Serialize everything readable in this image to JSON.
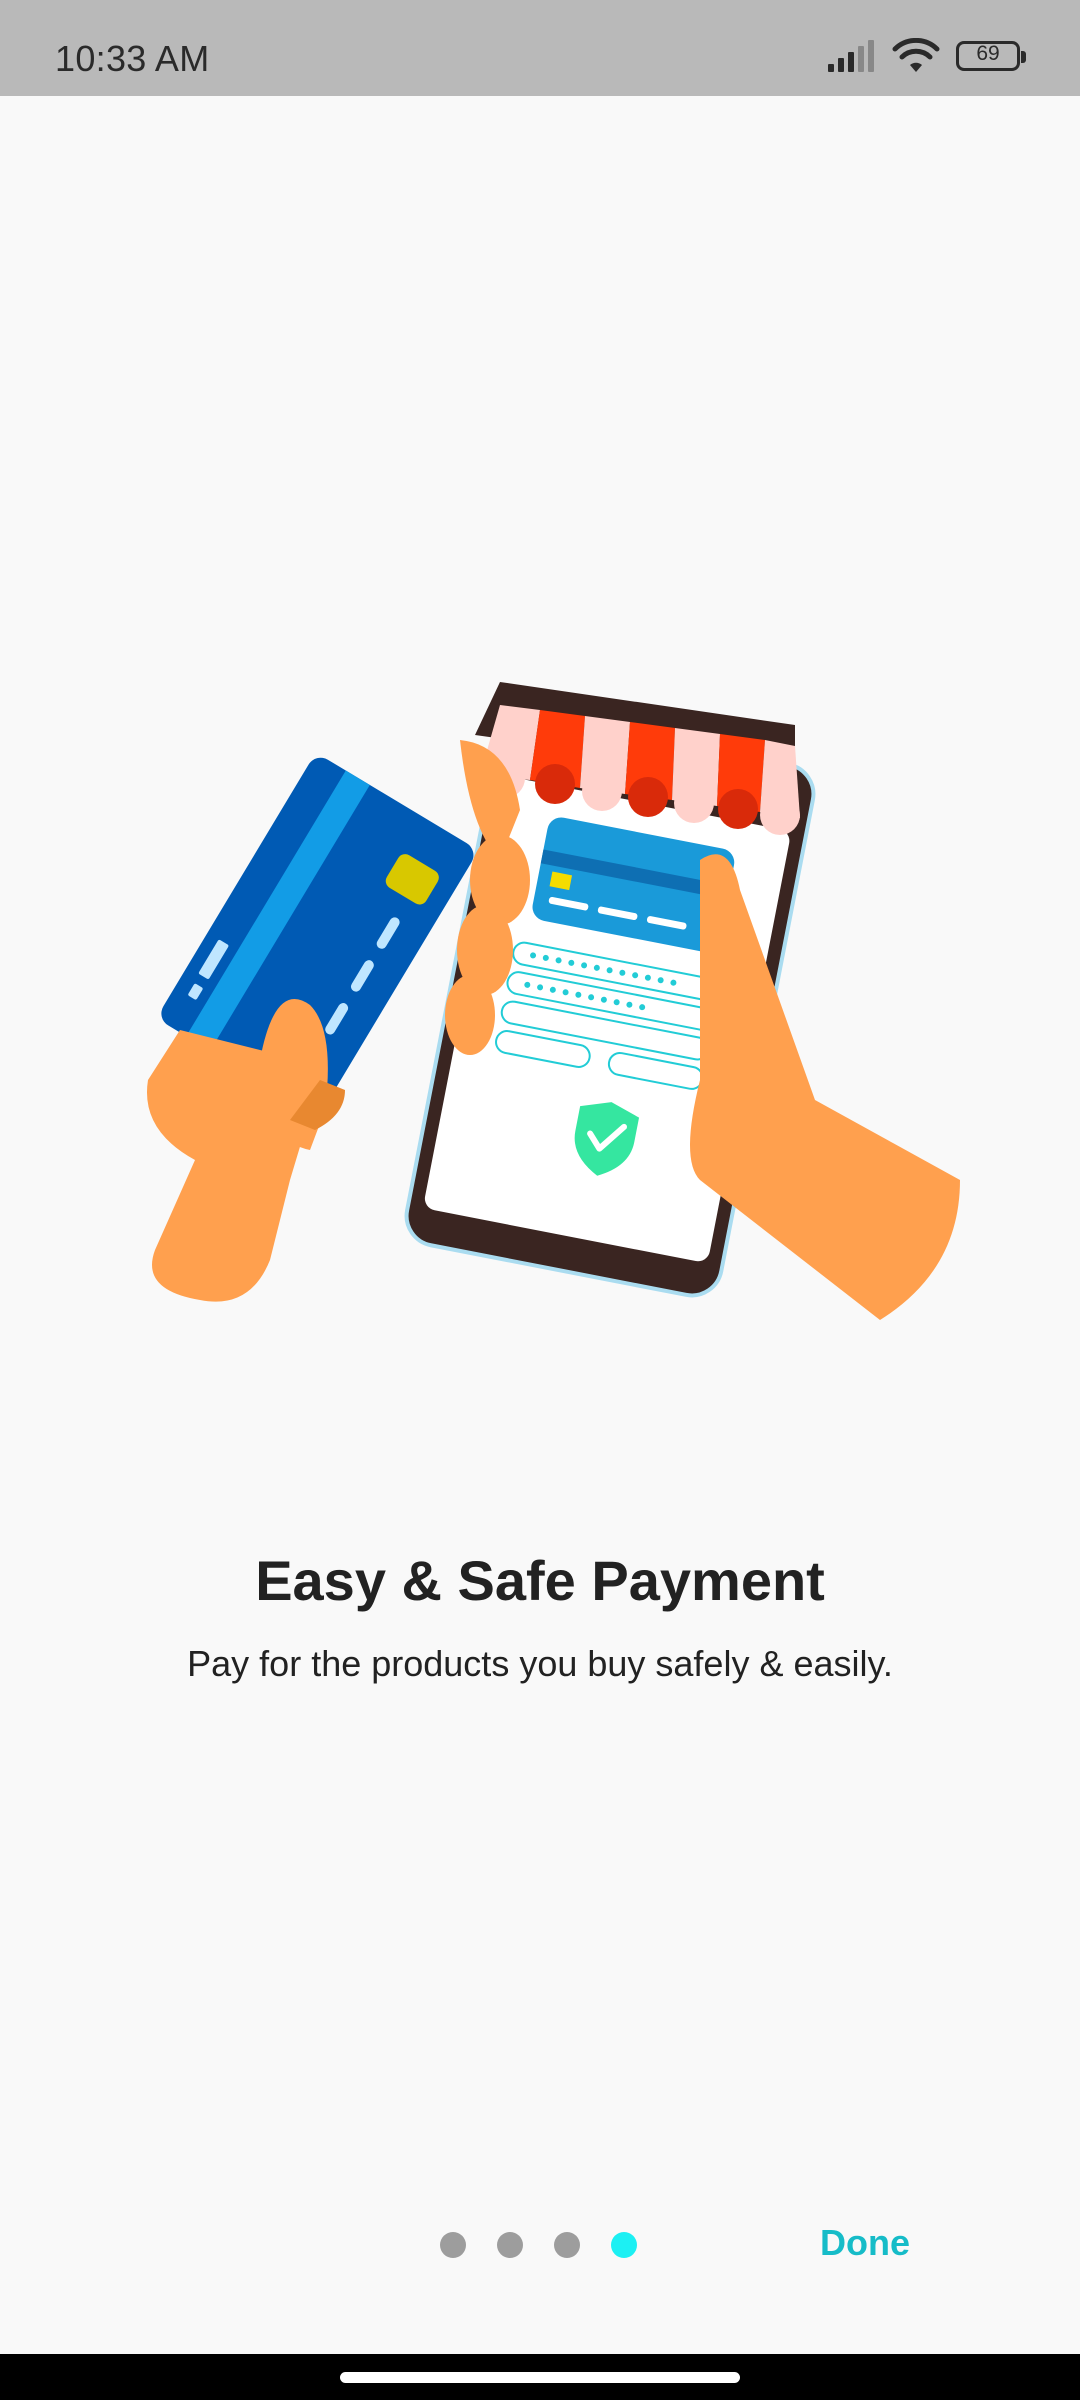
{
  "status_bar": {
    "time": "10:33 AM",
    "battery_level": "69",
    "icons": [
      "signal-icon",
      "wifi-icon",
      "battery-icon"
    ]
  },
  "illustration": {
    "icon": "card-payment-illustration"
  },
  "onboarding": {
    "title": "Easy & Safe Payment",
    "subtitle": "Pay for the products you buy safely & easily.",
    "page_indicator": {
      "total": 4,
      "current": 4
    },
    "done_label": "Done"
  },
  "colors": {
    "accent": "#16bcc8",
    "active_dot": "#1cf0f3",
    "inactive_dot": "#9d9d9d",
    "status_bar": "#b9b9b9",
    "background": "#f9f9f9"
  }
}
